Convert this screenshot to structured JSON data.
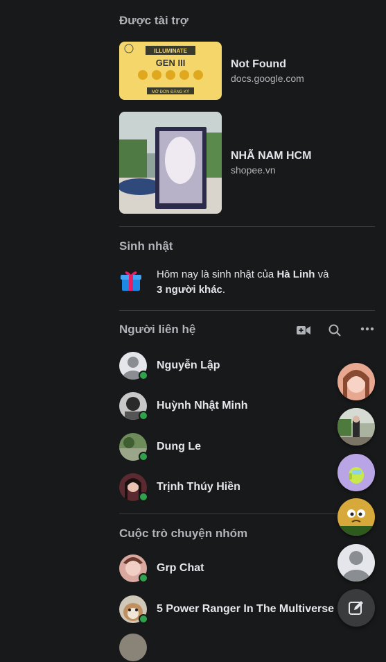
{
  "sponsored": {
    "title": "Được tài trợ",
    "ads": [
      {
        "name": "Not Found",
        "domain": "docs.google.com",
        "thumb_brand": "ILLUMINATE",
        "thumb_heading": "GEN III",
        "thumb_cta": "MỞ ĐƠN ĐĂNG KÝ"
      },
      {
        "name": "NHÃ NAM HCM",
        "domain": "shopee.vn"
      }
    ]
  },
  "birthday": {
    "title": "Sinh nhật",
    "text_prefix": "Hôm nay là sinh nhật của ",
    "name": "Hà Linh",
    "text_and": " và",
    "others": "3 người khác",
    "text_suffix": "."
  },
  "contacts": {
    "title": "Người liên hệ",
    "icons": [
      "video-call-icon",
      "search-icon",
      "more-icon"
    ],
    "items": [
      {
        "name": "Nguyễn Lập",
        "online": true
      },
      {
        "name": "Huỳnh Nhật Minh",
        "online": true
      },
      {
        "name": "Dung Le",
        "online": true
      },
      {
        "name": "Trịnh Thúy Hiền",
        "online": true
      }
    ]
  },
  "groups": {
    "title": "Cuộc trò chuyện nhóm",
    "items": [
      {
        "name": "Grp Chat",
        "online": true
      },
      {
        "name": "5 Power Ranger In The Multiverse",
        "online": true
      }
    ]
  },
  "colors": {
    "background": "#18191a",
    "online": "#31a24c",
    "secondary_text": "#b0b3b8"
  }
}
